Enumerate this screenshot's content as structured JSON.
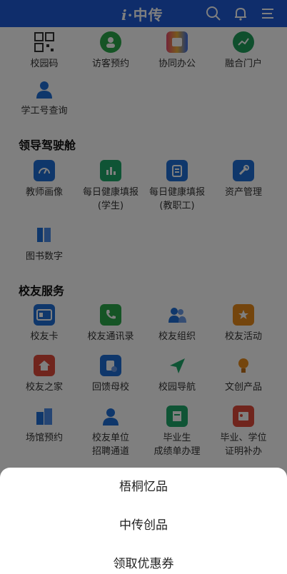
{
  "header": {
    "logo_i": "i",
    "logo_dot": "·",
    "logo_text": "中传"
  },
  "top_row": [
    {
      "label": "校园码",
      "icon": "qr-code-icon",
      "color": "#333333"
    },
    {
      "label": "访客预约",
      "icon": "visitor-icon",
      "color": "#2aa84a"
    },
    {
      "label": "协同办公",
      "icon": "office-icon",
      "color": "#e64a6e"
    },
    {
      "label": "融合门户",
      "icon": "portal-icon",
      "color": "#1e9e5a"
    }
  ],
  "second_row": [
    {
      "label": "学工号查询",
      "icon": "person-icon",
      "color": "#1e6fd6"
    }
  ],
  "sections": {
    "leader": {
      "title": "领导驾驶舱",
      "items": [
        {
          "label": "教师画像",
          "icon": "gauge-icon",
          "color": "#1e6fd6"
        },
        {
          "label": "每日健康填报\n(学生)",
          "icon": "chart-icon",
          "color": "#1fa86a"
        },
        {
          "label": "每日健康填报\n(教职工)",
          "icon": "form-icon",
          "color": "#1e6fd6"
        },
        {
          "label": "资产管理",
          "icon": "tool-icon",
          "color": "#1e6fd6"
        },
        {
          "label": "图书数字",
          "icon": "books-icon",
          "color": "#1e6fd6"
        }
      ]
    },
    "alumni": {
      "title": "校友服务",
      "items": [
        {
          "label": "校友卡",
          "icon": "card-icon",
          "color": "#1e6fd6"
        },
        {
          "label": "校友通讯录",
          "icon": "phone-icon",
          "color": "#2aa84a"
        },
        {
          "label": "校友组织",
          "icon": "group-icon",
          "color": "#1e6fd6"
        },
        {
          "label": "校友活动",
          "icon": "star-icon",
          "color": "#e88a1a"
        },
        {
          "label": "校友之家",
          "icon": "home-icon",
          "color": "#e04a3a"
        },
        {
          "label": "回馈母校",
          "icon": "gift-doc-icon",
          "color": "#1e6fd6"
        },
        {
          "label": "校园导航",
          "icon": "navigation-icon",
          "color": "#1fa86a"
        },
        {
          "label": "文创产品",
          "icon": "bulb-icon",
          "color": "#e88a1a"
        },
        {
          "label": "场馆预约",
          "icon": "building-icon",
          "color": "#1e6fd6"
        },
        {
          "label": "校友单位\n招聘通道",
          "icon": "recruit-icon",
          "color": "#1e6fd6"
        },
        {
          "label": "毕业生\n成绩单办理",
          "icon": "transcript-icon",
          "color": "#1fa86a"
        },
        {
          "label": "毕业、学位\n证明补办",
          "icon": "certificate-icon",
          "color": "#e04a3a"
        }
      ]
    }
  },
  "sheet": {
    "items": [
      "梧桐忆品",
      "中传创品",
      "领取优惠券"
    ]
  }
}
